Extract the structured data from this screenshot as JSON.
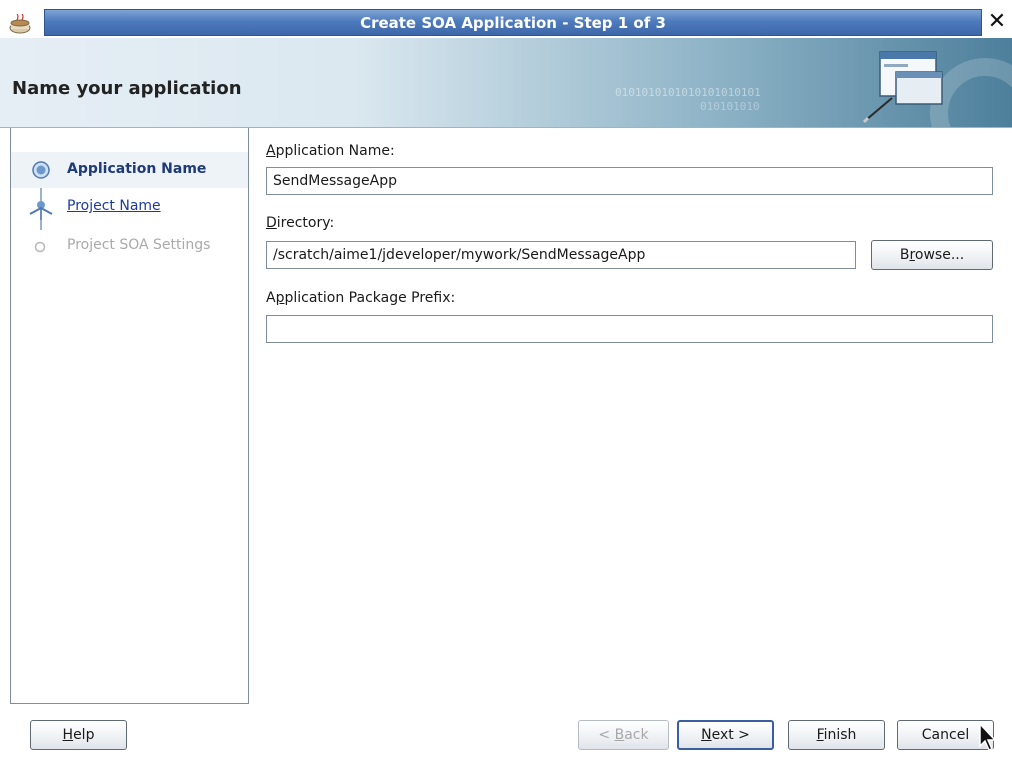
{
  "window": {
    "title": "Create SOA Application - Step 1 of 3",
    "close_glyph": "✕",
    "app_icon": "coffee-cup-icon"
  },
  "banner": {
    "heading": "Name your application",
    "binary_text_1": "0101010101010101010101",
    "binary_text_2": "010101010",
    "icon": "windows-wizard-icon"
  },
  "nav": {
    "items": [
      {
        "label": "Application Name",
        "state": "current"
      },
      {
        "label": "Project Name",
        "state": "link"
      },
      {
        "label": "Project SOA Settings",
        "state": "disabled"
      }
    ]
  },
  "form": {
    "app_name": {
      "label_mnemonic": "A",
      "label_rest": "pplication Name:",
      "value": "SendMessageApp"
    },
    "directory": {
      "label_mnemonic": "D",
      "label_rest": "irectory:",
      "value": "/scratch/aime1/jdeveloper/mywork/SendMessageApp"
    },
    "browse": {
      "pre": "B",
      "mnemonic": "r",
      "post": "owse..."
    },
    "prefix": {
      "pre": "A",
      "mnemonic": "p",
      "post": "plication Package Prefix:",
      "value": ""
    }
  },
  "buttons": {
    "help": {
      "mnemonic": "H",
      "rest": "elp"
    },
    "back": {
      "pre": "< ",
      "mnemonic": "B",
      "rest": "ack"
    },
    "next": {
      "mnemonic": "N",
      "rest": "ext >"
    },
    "finish": {
      "mnemonic": "F",
      "rest": "inish"
    },
    "cancel": {
      "label": "Cancel"
    }
  },
  "colors": {
    "title_bar": "#4e7bbd",
    "current_step": "#1f3a78",
    "link": "#1f3a9a",
    "disabled": "#a9a9a9"
  }
}
